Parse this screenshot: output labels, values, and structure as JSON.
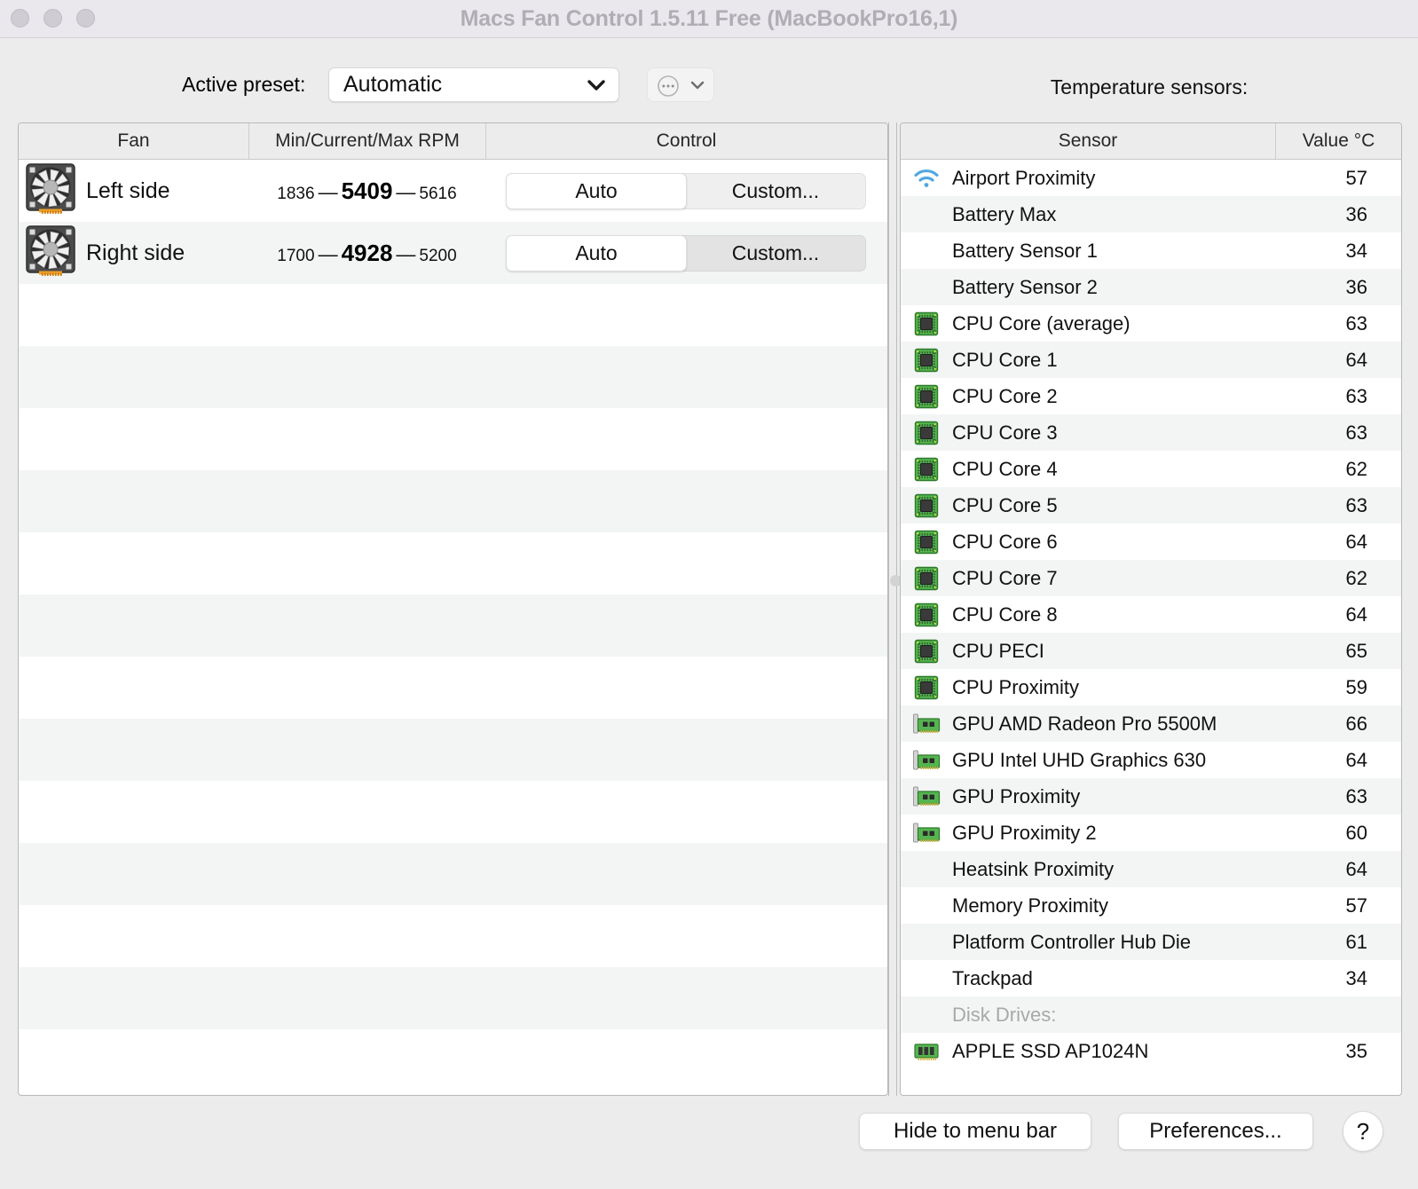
{
  "window": {
    "title": "Macs Fan Control 1.5.11 Free (MacBookPro16,1)"
  },
  "toolbar": {
    "preset_label": "Active preset:",
    "preset_value": "Automatic",
    "preset_menu_icon": "ellipsis-circle-icon",
    "temperature_sensors_label": "Temperature sensors:"
  },
  "fan_table": {
    "columns": [
      "Fan",
      "Min/Current/Max RPM",
      "Control"
    ],
    "rows": [
      {
        "icon": "fan-icon",
        "name": "Left side",
        "min": "1836",
        "current": "5409",
        "max": "5616",
        "dash": "—",
        "auto_label": "Auto",
        "custom_label": "Custom...",
        "mode": "Auto",
        "hovered": false
      },
      {
        "icon": "fan-icon",
        "name": "Right side",
        "min": "1700",
        "current": "4928",
        "max": "5200",
        "dash": "—",
        "auto_label": "Auto",
        "custom_label": "Custom...",
        "mode": "Auto",
        "hovered": true
      }
    ],
    "empty_row_count": 13
  },
  "sensor_table": {
    "columns": [
      "Sensor",
      "Value °C"
    ],
    "rows": [
      {
        "icon": "wifi-icon",
        "name": "Airport Proximity",
        "value": "57"
      },
      {
        "icon": "none",
        "name": "Battery Max",
        "value": "36"
      },
      {
        "icon": "none",
        "name": "Battery Sensor 1",
        "value": "34"
      },
      {
        "icon": "none",
        "name": "Battery Sensor 2",
        "value": "36"
      },
      {
        "icon": "cpu-icon",
        "name": "CPU Core (average)",
        "value": "63"
      },
      {
        "icon": "cpu-icon",
        "name": "CPU Core 1",
        "value": "64"
      },
      {
        "icon": "cpu-icon",
        "name": "CPU Core 2",
        "value": "63"
      },
      {
        "icon": "cpu-icon",
        "name": "CPU Core 3",
        "value": "63"
      },
      {
        "icon": "cpu-icon",
        "name": "CPU Core 4",
        "value": "62"
      },
      {
        "icon": "cpu-icon",
        "name": "CPU Core 5",
        "value": "63"
      },
      {
        "icon": "cpu-icon",
        "name": "CPU Core 6",
        "value": "64"
      },
      {
        "icon": "cpu-icon",
        "name": "CPU Core 7",
        "value": "62"
      },
      {
        "icon": "cpu-icon",
        "name": "CPU Core 8",
        "value": "64"
      },
      {
        "icon": "cpu-icon",
        "name": "CPU PECI",
        "value": "65"
      },
      {
        "icon": "cpu-icon",
        "name": "CPU Proximity",
        "value": "59"
      },
      {
        "icon": "gpu-icon",
        "name": "GPU AMD Radeon Pro 5500M",
        "value": "66"
      },
      {
        "icon": "gpu-icon",
        "name": "GPU Intel UHD Graphics 630",
        "value": "64"
      },
      {
        "icon": "gpu-icon",
        "name": "GPU Proximity",
        "value": "63"
      },
      {
        "icon": "gpu-icon",
        "name": "GPU Proximity 2",
        "value": "60"
      },
      {
        "icon": "none",
        "name": "Heatsink Proximity",
        "value": "64"
      },
      {
        "icon": "none",
        "name": "Memory Proximity",
        "value": "57"
      },
      {
        "icon": "none",
        "name": "Platform Controller Hub Die",
        "value": "61"
      },
      {
        "icon": "none",
        "name": "Trackpad",
        "value": "34"
      },
      {
        "icon": "none",
        "name": "Disk Drives:",
        "value": "",
        "section": true
      },
      {
        "icon": "ssd-icon",
        "name": "APPLE SSD AP1024N",
        "value": "35"
      }
    ]
  },
  "footer": {
    "hide_label": "Hide to menu bar",
    "preferences_label": "Preferences...",
    "help_label": "?"
  },
  "colors": {
    "titlebar_bg": "#ebe8ed",
    "window_bg": "#ececec",
    "row_alt": "#f3f5f5",
    "wifi_blue": "#53a8e0",
    "chip_green": "#4caf50",
    "fan_connector_orange": "#f0a028"
  }
}
